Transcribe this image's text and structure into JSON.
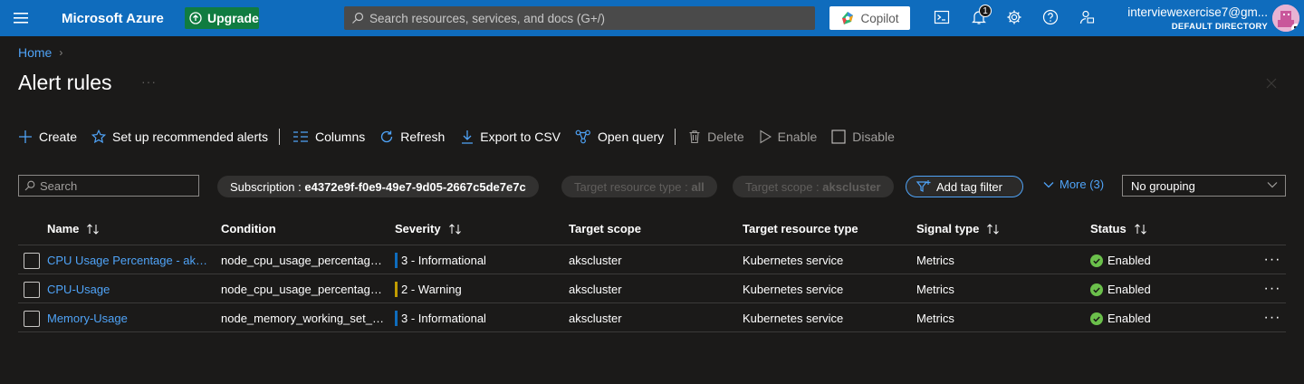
{
  "topbar": {
    "brand": "Microsoft Azure",
    "upgrade_label": "Upgrade",
    "search_placeholder": "Search resources, services, and docs (G+/)",
    "copilot_label": "Copilot",
    "notification_count": "1",
    "account_email": "interviewexercise7@gm...",
    "account_directory": "DEFAULT DIRECTORY",
    "colors": {
      "bar": "#0f6cbd",
      "upgrade": "#107c41"
    }
  },
  "breadcrumb": {
    "home": "Home"
  },
  "page": {
    "title": "Alert rules"
  },
  "toolbar": {
    "create": "Create",
    "recommended": "Set up recommended alerts",
    "columns": "Columns",
    "refresh": "Refresh",
    "export": "Export to CSV",
    "open_query": "Open query",
    "delete": "Delete",
    "enable": "Enable",
    "disable": "Disable"
  },
  "filters": {
    "search_placeholder": "Search",
    "subscription_label": "Subscription : ",
    "subscription_value": "e4372e9f-f0e9-49e7-9d05-2667c5de7e7c",
    "resource_type_label": "Target resource type : ",
    "resource_type_value": "all",
    "scope_label": "Target scope : ",
    "scope_value": "akscluster",
    "add_tag_filter": "Add tag filter",
    "more": "More (3)",
    "grouping": "No grouping"
  },
  "table": {
    "columns": {
      "name": "Name",
      "condition": "Condition",
      "severity": "Severity",
      "target_scope": "Target scope",
      "target_resource_type": "Target resource type",
      "signal_type": "Signal type",
      "status": "Status"
    },
    "rows": [
      {
        "name": "CPU Usage Percentage - akscl...",
        "condition": "node_cpu_usage_percentage ...",
        "severity": "3 - Informational",
        "severity_color": "#0f6cbd",
        "target_scope": "akscluster",
        "target_resource_type": "Kubernetes service",
        "signal_type": "Metrics",
        "status": "Enabled"
      },
      {
        "name": "CPU-Usage",
        "condition": "node_cpu_usage_percentage ...",
        "severity": "2 - Warning",
        "severity_color": "#c19c00",
        "target_scope": "akscluster",
        "target_resource_type": "Kubernetes service",
        "signal_type": "Metrics",
        "status": "Enabled"
      },
      {
        "name": "Memory-Usage",
        "condition": "node_memory_working_set_p...",
        "severity": "3 - Informational",
        "severity_color": "#0f6cbd",
        "target_scope": "akscluster",
        "target_resource_type": "Kubernetes service",
        "signal_type": "Metrics",
        "status": "Enabled"
      }
    ]
  }
}
